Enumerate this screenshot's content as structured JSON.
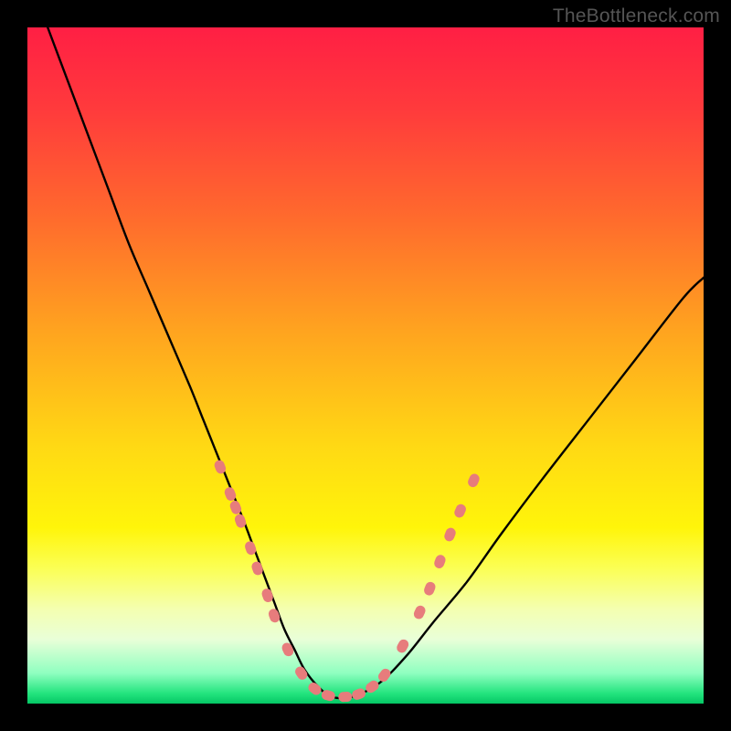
{
  "watermark": {
    "text": "TheBottleneck.com"
  },
  "colors": {
    "gradient_stops": [
      {
        "offset": 0.0,
        "color": "#ff1f44"
      },
      {
        "offset": 0.12,
        "color": "#ff3a3c"
      },
      {
        "offset": 0.28,
        "color": "#ff6a2d"
      },
      {
        "offset": 0.45,
        "color": "#ffa41f"
      },
      {
        "offset": 0.62,
        "color": "#ffd914"
      },
      {
        "offset": 0.74,
        "color": "#fff50a"
      },
      {
        "offset": 0.8,
        "color": "#fbff55"
      },
      {
        "offset": 0.86,
        "color": "#f4ffb0"
      },
      {
        "offset": 0.905,
        "color": "#e9ffd8"
      },
      {
        "offset": 0.955,
        "color": "#8fffc0"
      },
      {
        "offset": 0.985,
        "color": "#23e47e"
      },
      {
        "offset": 1.0,
        "color": "#05c765"
      }
    ],
    "curve": "#000000",
    "marker_fill": "#e77c7c",
    "marker_stroke": "#c85f5f"
  },
  "chart_data": {
    "type": "line",
    "title": "",
    "xlabel": "",
    "ylabel": "",
    "xlim": [
      0,
      100
    ],
    "ylim": [
      0,
      100
    ],
    "series": [
      {
        "name": "bottleneck-curve",
        "x": [
          3,
          6,
          9,
          12,
          15,
          18,
          21,
          24,
          26,
          28,
          30,
          32,
          33.5,
          35,
          36.5,
          38,
          39.5,
          41,
          43,
          45,
          48,
          52,
          56,
          60,
          65,
          70,
          76,
          83,
          90,
          97,
          100
        ],
        "y": [
          100,
          92,
          84,
          76,
          68,
          61,
          54,
          47,
          42,
          37,
          32,
          27,
          23,
          19,
          15,
          11,
          8,
          5,
          2.5,
          1,
          1,
          3,
          7,
          12,
          18,
          25,
          33,
          42,
          51,
          60,
          63
        ]
      }
    ],
    "markers": {
      "name": "highlight-points",
      "points": [
        {
          "x": 28.5,
          "y": 35
        },
        {
          "x": 30.0,
          "y": 31
        },
        {
          "x": 30.8,
          "y": 29
        },
        {
          "x": 31.5,
          "y": 27
        },
        {
          "x": 33.0,
          "y": 23
        },
        {
          "x": 34.0,
          "y": 20
        },
        {
          "x": 35.5,
          "y": 16
        },
        {
          "x": 36.5,
          "y": 13
        },
        {
          "x": 38.5,
          "y": 8
        },
        {
          "x": 40.5,
          "y": 4.5
        },
        {
          "x": 42.5,
          "y": 2.2
        },
        {
          "x": 44.5,
          "y": 1.2
        },
        {
          "x": 47.0,
          "y": 1.0
        },
        {
          "x": 49.0,
          "y": 1.4
        },
        {
          "x": 51.0,
          "y": 2.5
        },
        {
          "x": 52.8,
          "y": 4.2
        },
        {
          "x": 55.5,
          "y": 8.5
        },
        {
          "x": 58.0,
          "y": 13.5
        },
        {
          "x": 59.5,
          "y": 17
        },
        {
          "x": 61.0,
          "y": 21
        },
        {
          "x": 62.5,
          "y": 25
        },
        {
          "x": 64.0,
          "y": 28.5
        },
        {
          "x": 66.0,
          "y": 33
        }
      ]
    }
  }
}
